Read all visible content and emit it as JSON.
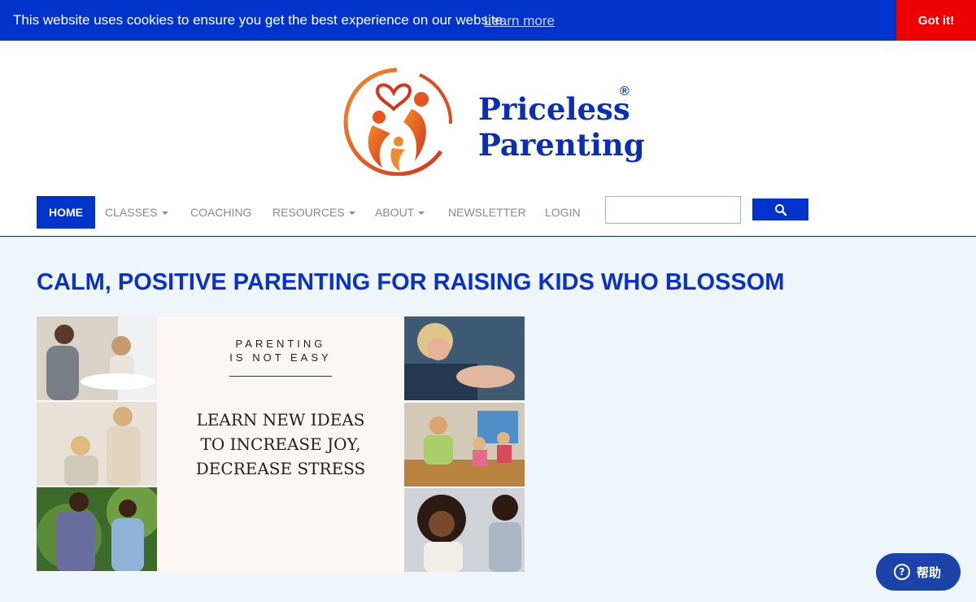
{
  "cookie_bar": {
    "message": "This website uses cookies to ensure you get the best experience on our website.",
    "learn_more": "Learn more",
    "accept": "Got it!"
  },
  "logo": {
    "line1": "Priceless",
    "line2": "Parenting",
    "registered": "®"
  },
  "nav": {
    "items": [
      {
        "label": "HOME",
        "active": true
      },
      {
        "label": "CLASSES",
        "dropdown": true
      },
      {
        "label": "COACHING"
      },
      {
        "label": "RESOURCES",
        "dropdown": true
      },
      {
        "label": "ABOUT",
        "dropdown": true
      },
      {
        "label": "NEWSLETTER"
      },
      {
        "label": "LOGIN"
      }
    ],
    "search_value": "",
    "search_icon": "search-icon"
  },
  "main": {
    "headline": "CALM, POSITIVE PARENTING FOR RAISING KIDS WHO BLOSSOM",
    "banner": {
      "kicker_line1": "PARENTING",
      "kicker_line2": "IS NOT EASY",
      "tagline_line1": "LEARN NEW IDEAS",
      "tagline_line2": "TO INCREASE JOY,",
      "tagline_line3": "DECREASE STRESS"
    }
  },
  "help": {
    "icon": "?",
    "label": "帮助"
  },
  "colors": {
    "brand_blue": "#0033cc",
    "accept_red": "#ee0000",
    "logo_orange": "#f07a22",
    "page_bg": "#eef5fb"
  }
}
